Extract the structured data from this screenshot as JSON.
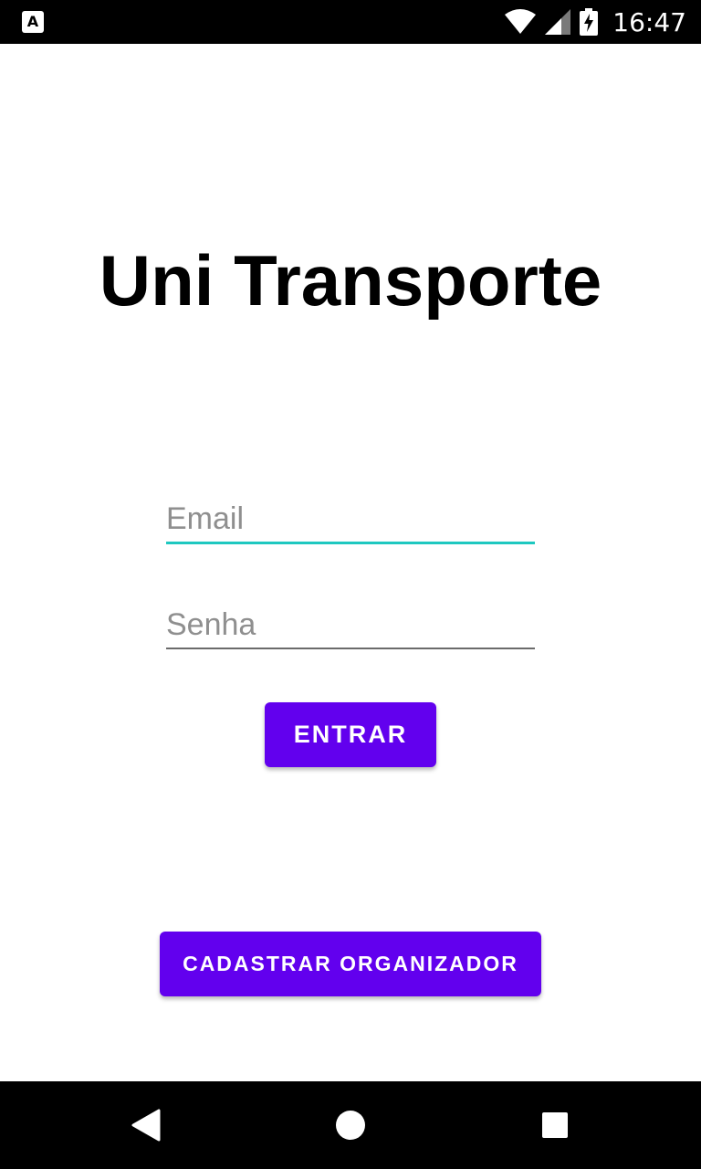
{
  "status_bar": {
    "time": "16:47",
    "left_icon_letter": "A",
    "icons": [
      "accessibility-icon",
      "wifi-icon",
      "signal-icon",
      "battery-charging-icon"
    ]
  },
  "app": {
    "title": "Uni Transporte"
  },
  "form": {
    "email": {
      "value": "",
      "placeholder": "Email"
    },
    "password": {
      "value": "",
      "placeholder": "Senha"
    },
    "login_button": "ENTRAR"
  },
  "register_button": "CADASTRAR ORGANIZADOR",
  "colors": {
    "primary": "#6200ee",
    "focused_underline": "#1ec8c0",
    "placeholder": "#8f8f8f"
  },
  "nav_bar": {
    "icons": [
      "back-icon",
      "home-icon",
      "recents-icon"
    ]
  }
}
